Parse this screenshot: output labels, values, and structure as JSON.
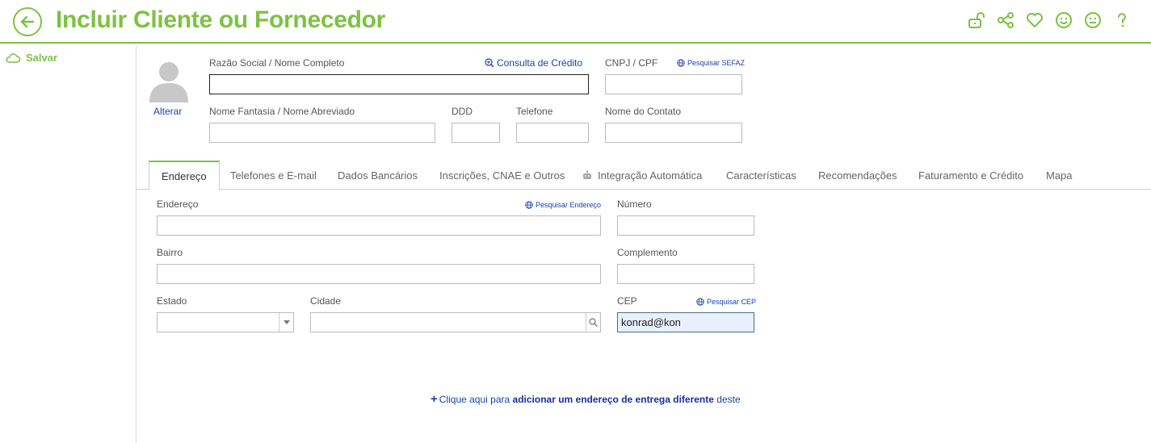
{
  "header": {
    "title": "Incluir Cliente ou Fornecedor",
    "icons": [
      "back-arrow-icon",
      "unlock-icon",
      "share-icon",
      "heart-icon",
      "smile-icon",
      "neutral-face-icon",
      "help-icon"
    ]
  },
  "sidebar": {
    "save_label": "Salvar"
  },
  "profile": {
    "change_photo": "Alterar"
  },
  "form": {
    "razao_label": "Razão Social / Nome Completo",
    "consulta_credito": "Consulta de Crédito",
    "cnpj_label": "CNPJ / CPF",
    "pesquisar_sefaz": "Pesquisar SEFAZ",
    "fantasia_label": "Nome Fantasia / Nome Abreviado",
    "ddd_label": "DDD",
    "telefone_label": "Telefone",
    "contato_label": "Nome do Contato",
    "razao_value": "",
    "cnpj_value": "",
    "fantasia_value": "",
    "ddd_value": "",
    "telefone_value": "",
    "contato_value": ""
  },
  "tabs": [
    {
      "label": "Endereço"
    },
    {
      "label": "Telefones e E-mail"
    },
    {
      "label": "Dados Bancários"
    },
    {
      "label": "Inscrições, CNAE e Outros"
    },
    {
      "label": "Integração Automática"
    },
    {
      "label": "Características"
    },
    {
      "label": "Recomendações"
    },
    {
      "label": "Faturamento e Crédito"
    },
    {
      "label": "Mapa"
    }
  ],
  "address": {
    "endereco_label": "Endereço",
    "pesquisar_endereco": "Pesquisar Endereço",
    "numero_label": "Número",
    "bairro_label": "Bairro",
    "complemento_label": "Complemento",
    "estado_label": "Estado",
    "cidade_label": "Cidade",
    "cep_label": "CEP",
    "pesquisar_cep": "Pesquisar CEP",
    "endereco_value": "",
    "numero_value": "",
    "bairro_value": "",
    "complemento_value": "",
    "estado_value": "",
    "cidade_value": "",
    "cep_value": "konrad@kon"
  },
  "add_delivery": {
    "prefix": "Clique aqui para",
    "bold": "adicionar um endereço de entrega diferente",
    "suffix": "deste"
  },
  "colors": {
    "accent": "#7dc242",
    "link": "#1a3fb0"
  }
}
